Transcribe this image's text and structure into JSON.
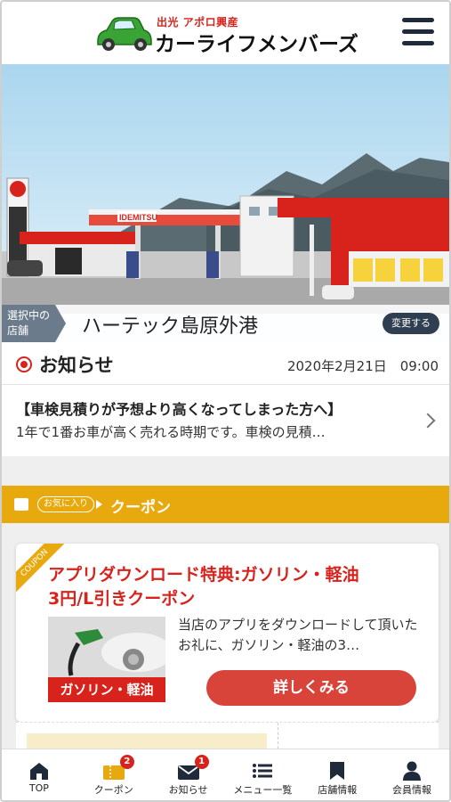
{
  "header": {
    "logo_sub": "出光 アポロ興産",
    "logo_main": "カーライフメンバーズ"
  },
  "store": {
    "tag_line1": "選択中の",
    "tag_line2": "店舗",
    "name": "ハーテック島原外港",
    "change_label": "変更する",
    "sign_text": "IDEMITSU"
  },
  "news": {
    "title": "お知らせ",
    "date": "2020年2月21日　09:00",
    "item_title": "【車検見積りが予想より高くなってしまった方へ】",
    "item_body": "1年で1番お車が高く売れる時期です。車検の見積…"
  },
  "coupon_section": {
    "fav_tag": "お気に入り",
    "label": "クーポン"
  },
  "coupon": {
    "ribbon": "COUPON",
    "title_line1": "アプリダウンロード特典:ガソリン・軽油",
    "title_line2": "3円/L引きクーポン",
    "image_label": "ガソリン・軽油",
    "desc": "当店のアプリをダウンロードして頂いたお礼に、ガソリン・軽油の3…",
    "detail_label": "詳しくみる"
  },
  "bottom_nav": {
    "items": [
      {
        "label": "TOP",
        "icon": "home-icon"
      },
      {
        "label": "クーポン",
        "icon": "coupon-icon",
        "badge": "2"
      },
      {
        "label": "お知らせ",
        "icon": "mail-icon",
        "badge": "1"
      },
      {
        "label": "メニュー一覧",
        "icon": "menu-list-icon"
      },
      {
        "label": "店舗情報",
        "icon": "store-icon"
      },
      {
        "label": "会員情報",
        "icon": "member-icon"
      }
    ]
  },
  "colors": {
    "accent_red": "#d8231d",
    "coupon_yellow": "#e8a90e",
    "navy": "#1f2a3a"
  }
}
